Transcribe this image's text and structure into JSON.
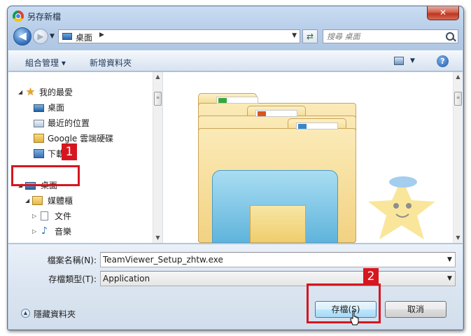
{
  "window": {
    "title": "另存新檔",
    "close_label": "✕"
  },
  "navbar": {
    "address": "桌面",
    "search_placeholder": "搜尋 桌面"
  },
  "toolbar": {
    "organize_label": "組合管理 ▾",
    "new_folder_label": "新增資料夾",
    "help_label": "?"
  },
  "nav_tree": {
    "favorites": "我的最愛",
    "favorites_items": [
      "桌面",
      "最近的位置",
      "Google 雲端硬碟",
      "下載"
    ],
    "desktop": "桌面",
    "libraries": "媒體櫃",
    "library_items": [
      "文件",
      "音樂"
    ]
  },
  "form": {
    "filename_label": "檔案名稱(N):",
    "filename_value": "TeamViewer_Setup_zhtw.exe",
    "filetype_label": "存檔類型(T):",
    "filetype_value": "Application",
    "hide_folders_label": "隱藏資料夾",
    "save_label": "存檔(S)",
    "cancel_label": "取消"
  },
  "annotations": {
    "step1": "1",
    "step2": "2"
  },
  "colors": {
    "annotation": "#d6161f",
    "accent": "#3c7fb1"
  }
}
